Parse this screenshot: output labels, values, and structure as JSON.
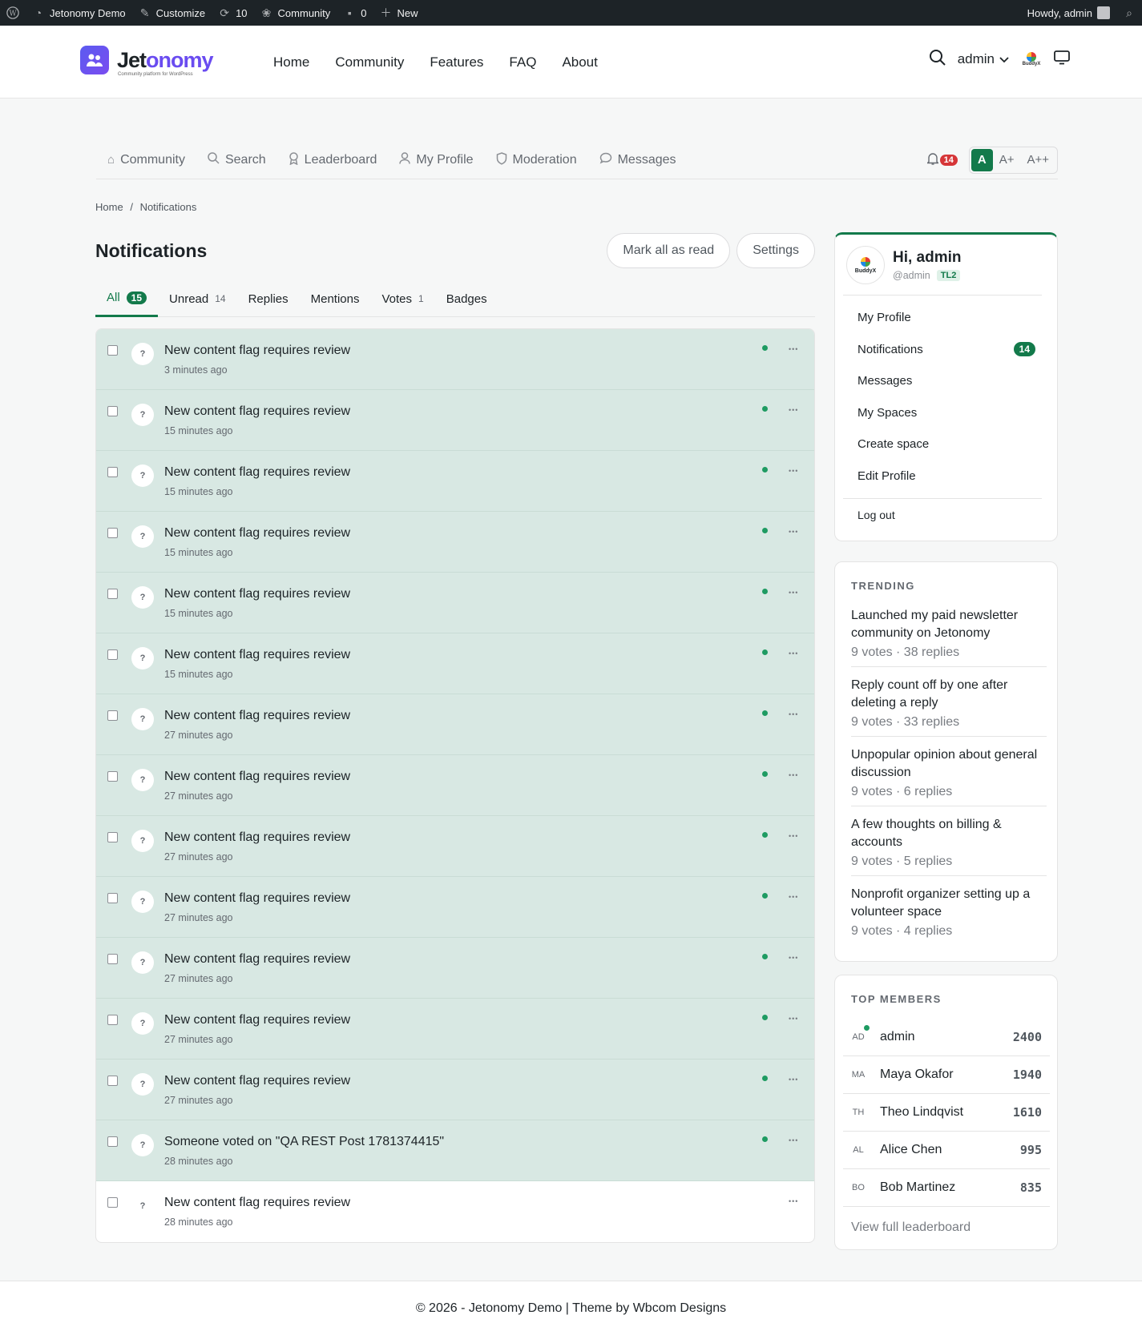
{
  "adminbar": {
    "site": "Jetonomy Demo",
    "customize": "Customize",
    "updates": "10",
    "community": "Community",
    "comments": "0",
    "new": "New",
    "howdy": "Howdy, admin"
  },
  "header": {
    "logo_text_a": "Jet",
    "logo_text_b": "onomy",
    "logo_sub": "Community platform for WordPress",
    "nav": [
      "Home",
      "Community",
      "Features",
      "FAQ",
      "About"
    ],
    "user": "admin",
    "badge": "BuddyX"
  },
  "subnav": {
    "items": [
      {
        "label": "Community",
        "icon": "home-icon"
      },
      {
        "label": "Search",
        "icon": "search-icon"
      },
      {
        "label": "Leaderboard",
        "icon": "award-icon"
      },
      {
        "label": "My Profile",
        "icon": "user-icon"
      },
      {
        "label": "Moderation",
        "icon": "shield-icon"
      },
      {
        "label": "Messages",
        "icon": "message-icon"
      }
    ],
    "bell_count": "14",
    "font_sizes": [
      "A",
      "A+",
      "A++"
    ]
  },
  "breadcrumb": {
    "home": "Home",
    "sep": "/",
    "current": "Notifications"
  },
  "page": {
    "title": "Notifications",
    "mark_all": "Mark all as read",
    "settings": "Settings"
  },
  "tabs": [
    {
      "label": "All",
      "count": "15"
    },
    {
      "label": "Unread",
      "count": "14"
    },
    {
      "label": "Replies",
      "count": ""
    },
    {
      "label": "Mentions",
      "count": ""
    },
    {
      "label": "Votes",
      "count": "1"
    },
    {
      "label": "Badges",
      "count": ""
    }
  ],
  "notifications": [
    {
      "avatar": "?",
      "text": "New content flag requires review",
      "time": "3 minutes ago",
      "unread": true
    },
    {
      "avatar": "?",
      "text": "New content flag requires review",
      "time": "15 minutes ago",
      "unread": true
    },
    {
      "avatar": "?",
      "text": "New content flag requires review",
      "time": "15 minutes ago",
      "unread": true
    },
    {
      "avatar": "?",
      "text": "New content flag requires review",
      "time": "15 minutes ago",
      "unread": true
    },
    {
      "avatar": "?",
      "text": "New content flag requires review",
      "time": "15 minutes ago",
      "unread": true
    },
    {
      "avatar": "?",
      "text": "New content flag requires review",
      "time": "15 minutes ago",
      "unread": true
    },
    {
      "avatar": "?",
      "text": "New content flag requires review",
      "time": "27 minutes ago",
      "unread": true
    },
    {
      "avatar": "?",
      "text": "New content flag requires review",
      "time": "27 minutes ago",
      "unread": true
    },
    {
      "avatar": "?",
      "text": "New content flag requires review",
      "time": "27 minutes ago",
      "unread": true
    },
    {
      "avatar": "?",
      "text": "New content flag requires review",
      "time": "27 minutes ago",
      "unread": true
    },
    {
      "avatar": "?",
      "text": "New content flag requires review",
      "time": "27 minutes ago",
      "unread": true
    },
    {
      "avatar": "?",
      "text": "New content flag requires review",
      "time": "27 minutes ago",
      "unread": true
    },
    {
      "avatar": "?",
      "text": "New content flag requires review",
      "time": "27 minutes ago",
      "unread": true
    },
    {
      "avatar": "?",
      "text": "Someone voted on \"QA REST Post 1781374415\"",
      "time": "28 minutes ago",
      "unread": true
    },
    {
      "avatar": "?",
      "text": "New content flag requires review",
      "time": "28 minutes ago",
      "unread": false
    }
  ],
  "user_card": {
    "greeting": "Hi, admin",
    "handle": "@admin",
    "level": "TL2",
    "avatar": "BuddyX",
    "menu": [
      {
        "label": "My Profile",
        "badge": ""
      },
      {
        "label": "Notifications",
        "badge": "14"
      },
      {
        "label": "Messages",
        "badge": ""
      },
      {
        "label": "My Spaces",
        "badge": ""
      },
      {
        "label": "Create space",
        "badge": ""
      },
      {
        "label": "Edit Profile",
        "badge": ""
      }
    ],
    "logout": "Log out"
  },
  "trending": {
    "title": "TRENDING",
    "items": [
      {
        "title": "Launched my paid newsletter community on Jetonomy",
        "meta": "9 votes · 38 replies"
      },
      {
        "title": "Reply count off by one after deleting a reply",
        "meta": "9 votes · 33 replies"
      },
      {
        "title": "Unpopular opinion about general discussion",
        "meta": "9 votes · 6 replies"
      },
      {
        "title": "A few thoughts on billing & accounts",
        "meta": "9 votes · 5 replies"
      },
      {
        "title": "Nonprofit organizer setting up a volunteer space",
        "meta": "9 votes · 4 replies"
      }
    ]
  },
  "members": {
    "title": "TOP MEMBERS",
    "items": [
      {
        "initials": "AD",
        "name": "admin",
        "points": "2400",
        "online": true
      },
      {
        "initials": "MA",
        "name": "Maya Okafor",
        "points": "1940",
        "online": false
      },
      {
        "initials": "TH",
        "name": "Theo Lindqvist",
        "points": "1610",
        "online": false
      },
      {
        "initials": "AL",
        "name": "Alice Chen",
        "points": "995",
        "online": false
      },
      {
        "initials": "BO",
        "name": "Bob Martinez",
        "points": "835",
        "online": false
      }
    ],
    "view_all": "View full leaderboard"
  },
  "footer": {
    "text": "© 2026 - Jetonomy Demo | Theme by Wbcom Designs"
  },
  "colors": {
    "accent": "#137a4b",
    "unread_bg": "#d8e8e3",
    "danger": "#d63638",
    "brand": "#6a4cf0"
  }
}
